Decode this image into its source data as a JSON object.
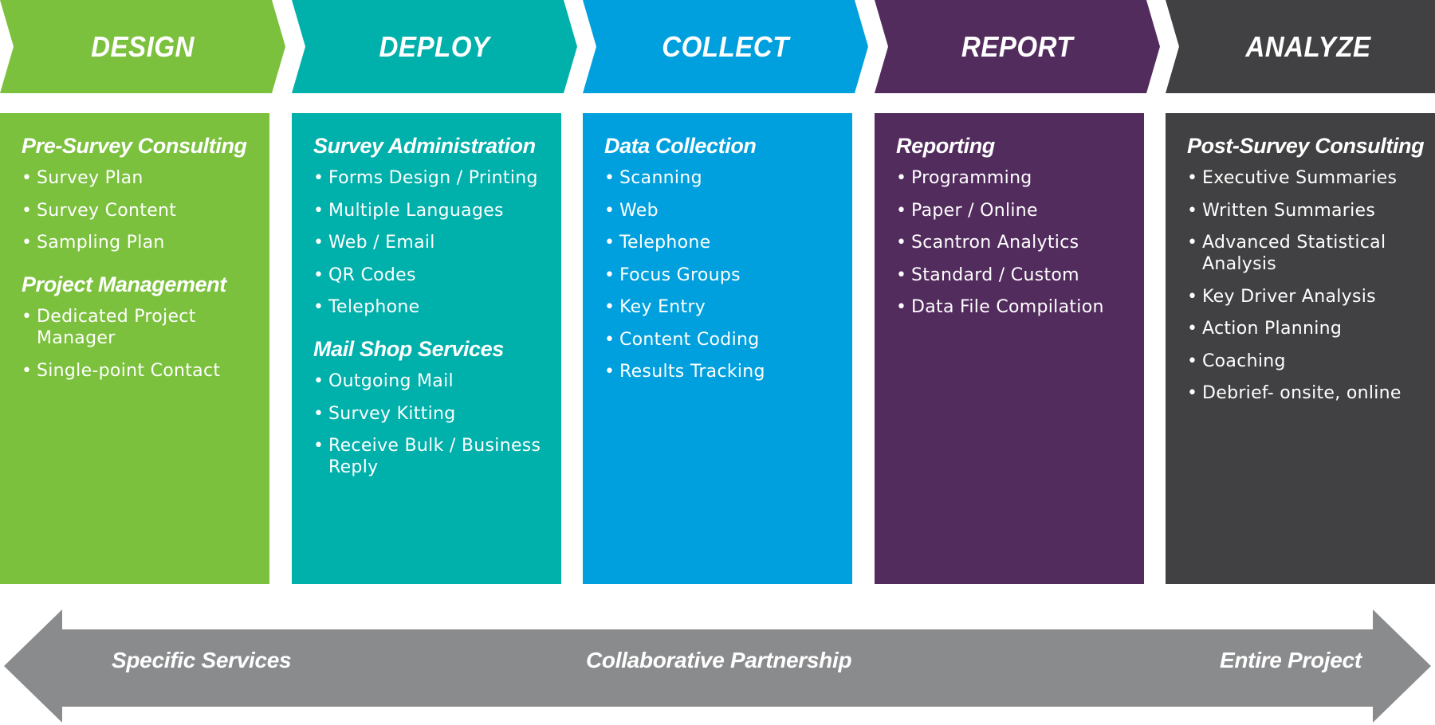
{
  "stages": [
    {
      "title": "DESIGN",
      "color": "#7CC13E",
      "sections": [
        {
          "heading": "Pre-Survey Consulting",
          "items": [
            "Survey Plan",
            "Survey Content",
            "Sampling Plan"
          ]
        },
        {
          "heading": "Project Management",
          "items": [
            "Dedicated Project Manager",
            "Single-point Contact"
          ]
        }
      ]
    },
    {
      "title": "DEPLOY",
      "color": "#00B0AB",
      "sections": [
        {
          "heading": "Survey Administration",
          "items": [
            "Forms Design / Printing",
            "Multiple Languages",
            "Web / Email",
            "QR Codes",
            "Telephone"
          ]
        },
        {
          "heading": "Mail Shop Services",
          "items": [
            "Outgoing Mail",
            "Survey Kitting",
            "Receive Bulk / Business Reply"
          ]
        }
      ]
    },
    {
      "title": "COLLECT",
      "color": "#00A0DE",
      "sections": [
        {
          "heading": "Data Collection",
          "items": [
            "Scanning",
            "Web",
            "Telephone",
            "Focus Groups",
            "Key Entry",
            "Content Coding",
            "Results Tracking"
          ]
        }
      ]
    },
    {
      "title": "REPORT",
      "color": "#532C5E",
      "sections": [
        {
          "heading": "Reporting",
          "items": [
            "Programming",
            "Paper / Online",
            "Scantron Analytics",
            "Standard / Custom",
            "Data File Compilation"
          ]
        }
      ]
    },
    {
      "title": "ANALYZE",
      "color": "#414042",
      "sections": [
        {
          "heading": "Post-Survey Consulting",
          "items": [
            "Executive Summaries",
            "Written Summaries",
            "Advanced Statistical Analysis",
            "Key Driver Analysis",
            "Action Planning",
            "Coaching",
            "Debrief- onsite, online"
          ]
        }
      ]
    }
  ],
  "bullet_glyph": "•",
  "bottom_arrow": {
    "color": "#8A8B8D",
    "left_label": "Specific Services",
    "center_label": "Collaborative Partnership",
    "right_label": "Entire Project"
  }
}
